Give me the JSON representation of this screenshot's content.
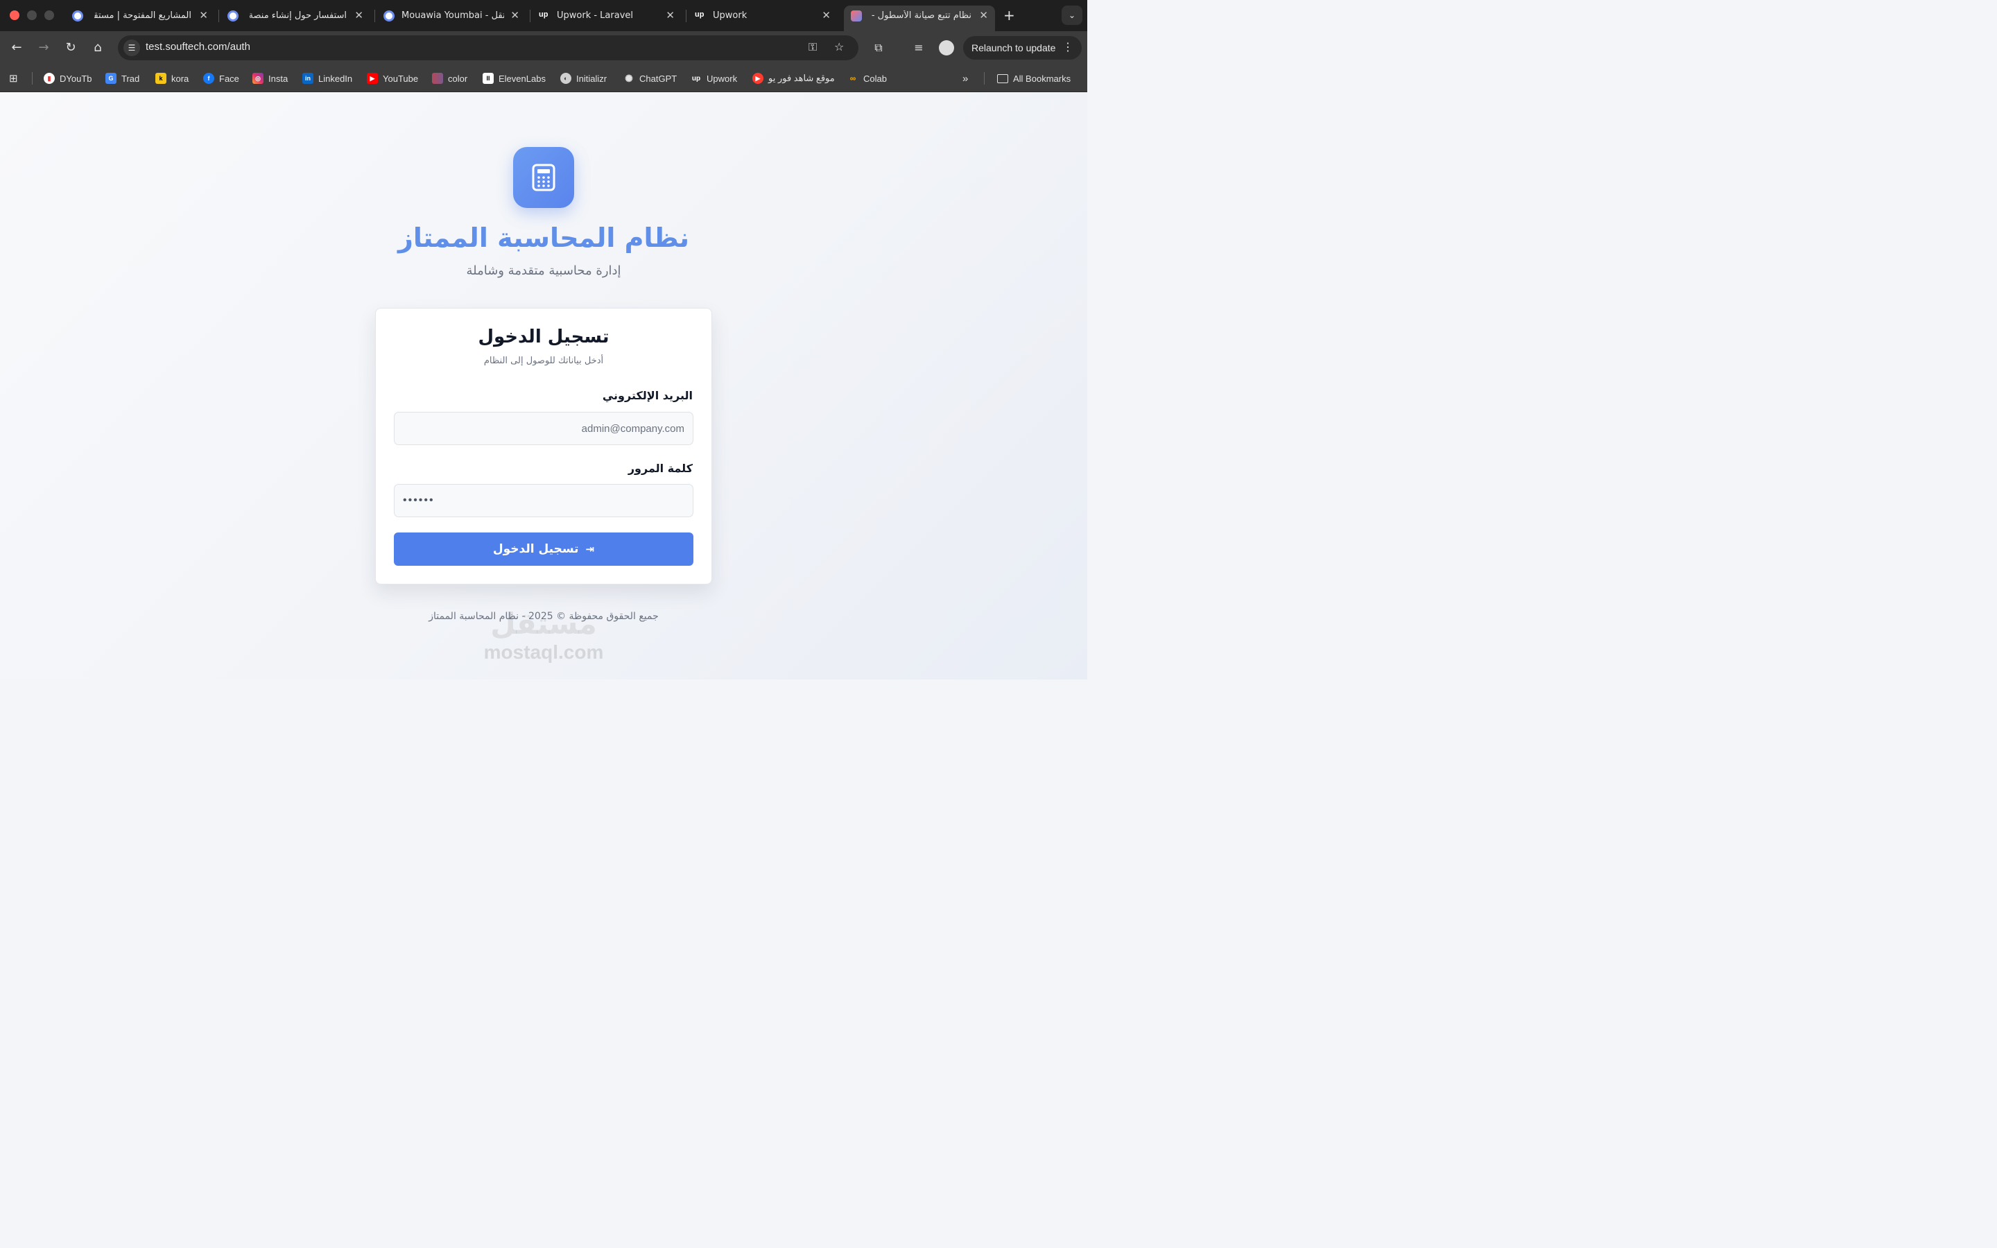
{
  "browser": {
    "tabs": [
      {
        "title": "المشاريع المفتوحة | مستقل",
        "favicon": "mostaql-ring-icon"
      },
      {
        "title": "استفسار حول إنشاء منصة لع",
        "favicon": "mostaql-ring-icon"
      },
      {
        "title": "Mouawia Youmbai - مستقل",
        "favicon": "mostaql-ring-icon"
      },
      {
        "title": "Upwork - Laravel",
        "favicon": "upwork-icon"
      },
      {
        "title": "Upwork",
        "favicon": "upwork-icon"
      },
      {
        "title": "نظام تتبع صيانة الأسطول - لو",
        "favicon": "app-icon",
        "active": true
      }
    ],
    "new_tab": "+",
    "tab_menu": "⌄",
    "url": "test.souftech.com/auth",
    "relaunch_label": "Relaunch to update",
    "bookmarks": [
      {
        "label": "DYouTb",
        "color": "#ffffff"
      },
      {
        "label": "Trad",
        "color": "#4285f4"
      },
      {
        "label": "kora",
        "color": "#f5c518"
      },
      {
        "label": "Face",
        "color": "#1877f2"
      },
      {
        "label": "Insta",
        "color": "#e1306c"
      },
      {
        "label": "LinkedIn",
        "color": "#0a66c2"
      },
      {
        "label": "YouTube",
        "color": "#ff0000"
      },
      {
        "label": "color",
        "color": "#b5475b"
      },
      {
        "label": "ElevenLabs",
        "color": "#ffffff"
      },
      {
        "label": "Initializr",
        "color": "#cfcfcf"
      },
      {
        "label": "ChatGPT",
        "color": "#cfcfcf"
      },
      {
        "label": "Upwork",
        "color": "#ffffff"
      },
      {
        "label": "موقع شاهد فور يو",
        "color": "#ff3b30"
      },
      {
        "label": "Colab",
        "color": "#f9ab00"
      }
    ],
    "all_bookmarks": "All Bookmarks"
  },
  "app": {
    "title": "نظام المحاسبة الممتاز",
    "subtitle": "إدارة محاسبية متقدمة وشاملة",
    "accent_color": "#5a84ec"
  },
  "login": {
    "title": "تسجيل الدخول",
    "subtitle": "أدخل بياناتك للوصول إلى النظام",
    "email_label": "البريد الإلكتروني",
    "email_value": "admin@company.com",
    "password_label": "كلمة المرور",
    "password_value": "••••••",
    "submit_label": "تسجيل الدخول"
  },
  "footer": {
    "text": "جميع الحقوق محفوظة © 2025 - نظام المحاسبة الممتاز"
  },
  "watermark": {
    "arabic": "مستقل",
    "latin": "mostaql.com"
  }
}
